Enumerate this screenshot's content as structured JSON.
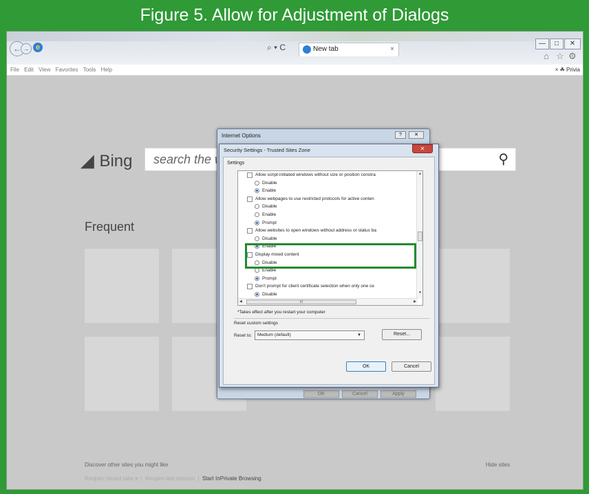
{
  "figure_title": "Figure 5. Allow for Adjustment of Dialogs",
  "browser": {
    "search_glyph": "⌕ ▾ C",
    "tab_title": "New tab",
    "tab_close": "×",
    "menu": [
      "File",
      "Edit",
      "View",
      "Favorites",
      "Tools",
      "Help"
    ],
    "toolbar_right": "×  ☘  Privia"
  },
  "bing": {
    "logo_text": "Bing",
    "search_placeholder": "search the w",
    "frequent_label": "Frequent",
    "discover_text": "Discover other sites you might like",
    "hide_sites": "Hide sites",
    "reopen_closed": "Reopen closed tabs ▾",
    "reopen_last": "Reopen last session",
    "inprivate": "Start InPrivate Browsing"
  },
  "internet_options": {
    "title": "Internet Options",
    "help_label": "?",
    "close_label": "✕",
    "ghost_buttons": [
      "OK",
      "Cancel",
      "Apply"
    ]
  },
  "security_dialog": {
    "title": "Security Settings - Trusted Sites Zone",
    "close_label": "✕",
    "settings_label": "Settings",
    "items": [
      {
        "kind": "check",
        "text": "Allow script-initiated windows without size or position constra"
      },
      {
        "kind": "radio",
        "text": "Disable",
        "on": false
      },
      {
        "kind": "radio",
        "text": "Enable",
        "on": true
      },
      {
        "kind": "check",
        "text": "Allow webpages to use restricted protocols for active conten"
      },
      {
        "kind": "radio",
        "text": "Disable",
        "on": false
      },
      {
        "kind": "radio",
        "text": "Enable",
        "on": false
      },
      {
        "kind": "radio",
        "text": "Prompt",
        "on": true
      },
      {
        "kind": "check",
        "text": "Allow websites to open windows without address or status ba"
      },
      {
        "kind": "radio",
        "text": "Disable",
        "on": false
      },
      {
        "kind": "radio",
        "text": "Enable",
        "on": true
      },
      {
        "kind": "check",
        "text": "Display mixed content"
      },
      {
        "kind": "radio",
        "text": "Disable",
        "on": false
      },
      {
        "kind": "radio",
        "text": "Enable",
        "on": false
      },
      {
        "kind": "radio",
        "text": "Prompt",
        "on": true
      },
      {
        "kind": "check",
        "text": "Don't prompt for client certificate selection when only one ce"
      },
      {
        "kind": "radio",
        "text": "Disable",
        "on": true
      }
    ],
    "scroll_thumb_label": "III",
    "takes_effect_note": "*Takes effect after you restart your computer",
    "reset_group_label": "Reset custom settings",
    "reset_to_label": "Reset to:",
    "reset_value": "Medium (default)",
    "reset_button": "Reset...",
    "ok_button": "OK",
    "cancel_button": "Cancel"
  },
  "colors": {
    "frame_green": "#2f9a36",
    "highlight_green": "#1f8c2d"
  }
}
